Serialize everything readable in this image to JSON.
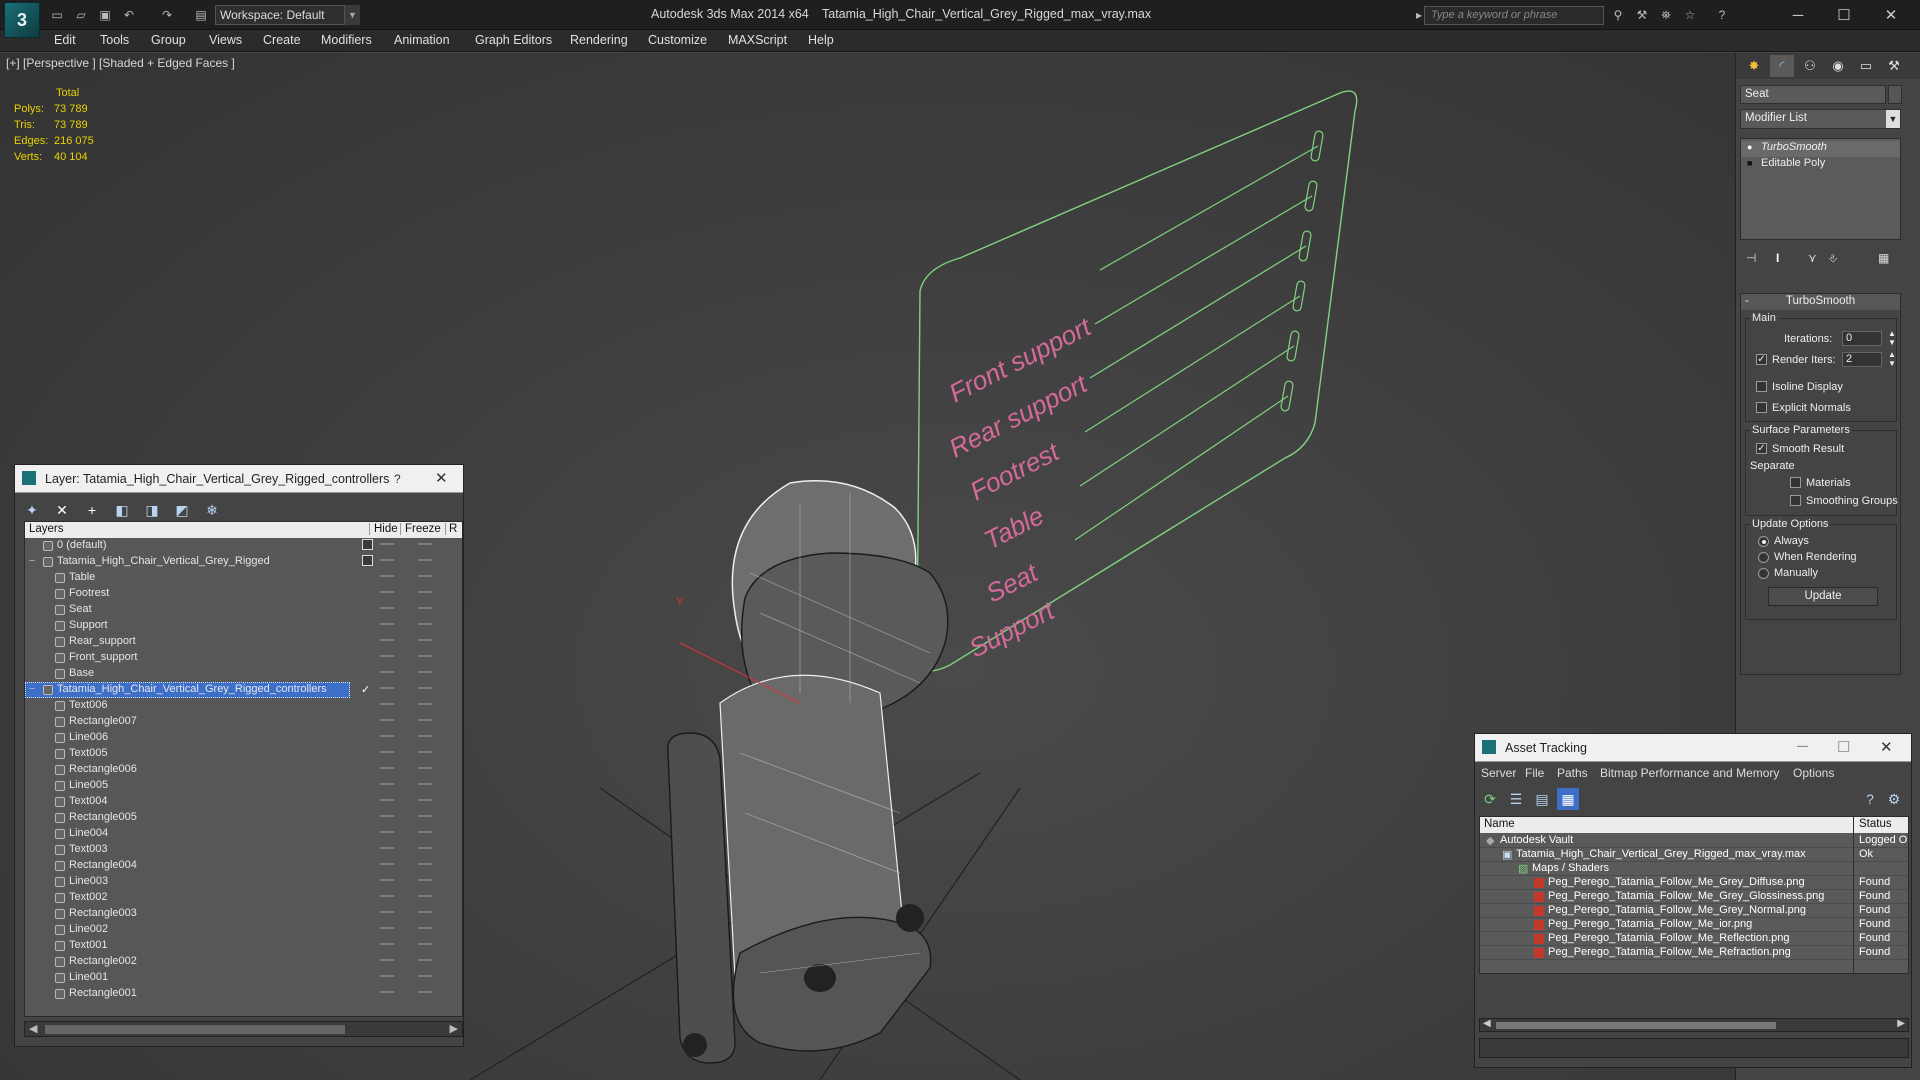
{
  "titlebar": {
    "workspace": "Workspace: Default",
    "app_title": "Autodesk 3ds Max  2014 x64",
    "file_title": "Tatamia_High_Chair_Vertical_Grey_Rigged_max_vray.max",
    "search_placeholder": "Type a keyword or phrase"
  },
  "menubar": [
    "Edit",
    "Tools",
    "Group",
    "Views",
    "Create",
    "Modifiers",
    "Animation",
    "Graph Editors",
    "Rendering",
    "Customize",
    "MAXScript",
    "Help"
  ],
  "viewport": {
    "label": "[+] [Perspective ] [Shaded + Edged Faces ]",
    "stats": {
      "header": "Total",
      "rows": [
        {
          "k": "Polys:",
          "v": "73 789"
        },
        {
          "k": "Tris:",
          "v": "73 789"
        },
        {
          "k": "Edges:",
          "v": "216 075"
        },
        {
          "k": "Verts:",
          "v": "40 104"
        }
      ]
    },
    "controller_labels": [
      "Front support",
      "Rear support",
      "Footrest",
      "Table",
      "Seat",
      "Support"
    ],
    "axis_y": "Y"
  },
  "layer_dialog": {
    "title": "Layer: Tatamia_High_Chair_Vertical_Grey_Rigged_controllers",
    "help": "?",
    "columns": {
      "layers": "Layers",
      "hide": "Hide",
      "freeze": "Freeze",
      "render": "R"
    },
    "rows": [
      {
        "name": "0 (default)",
        "level": 0,
        "kind": "layer",
        "check": true
      },
      {
        "name": "Tatamia_High_Chair_Vertical_Grey_Rigged",
        "level": 0,
        "kind": "layer",
        "check": true,
        "expander": "−"
      },
      {
        "name": "Table",
        "level": 1,
        "kind": "obj"
      },
      {
        "name": "Footrest",
        "level": 1,
        "kind": "obj"
      },
      {
        "name": "Seat",
        "level": 1,
        "kind": "obj"
      },
      {
        "name": "Support",
        "level": 1,
        "kind": "obj"
      },
      {
        "name": "Rear_support",
        "level": 1,
        "kind": "obj"
      },
      {
        "name": "Front_support",
        "level": 1,
        "kind": "obj"
      },
      {
        "name": "Base",
        "level": 1,
        "kind": "obj"
      },
      {
        "name": "Tatamia_High_Chair_Vertical_Grey_Rigged_controllers",
        "level": 0,
        "kind": "layer",
        "selected": true,
        "active": "✓",
        "expander": "−"
      },
      {
        "name": "Text006",
        "level": 1,
        "kind": "obj"
      },
      {
        "name": "Rectangle007",
        "level": 1,
        "kind": "obj"
      },
      {
        "name": "Line006",
        "level": 1,
        "kind": "obj"
      },
      {
        "name": "Text005",
        "level": 1,
        "kind": "obj"
      },
      {
        "name": "Rectangle006",
        "level": 1,
        "kind": "obj"
      },
      {
        "name": "Line005",
        "level": 1,
        "kind": "obj"
      },
      {
        "name": "Text004",
        "level": 1,
        "kind": "obj"
      },
      {
        "name": "Rectangle005",
        "level": 1,
        "kind": "obj"
      },
      {
        "name": "Line004",
        "level": 1,
        "kind": "obj"
      },
      {
        "name": "Text003",
        "level": 1,
        "kind": "obj"
      },
      {
        "name": "Rectangle004",
        "level": 1,
        "kind": "obj"
      },
      {
        "name": "Line003",
        "level": 1,
        "kind": "obj"
      },
      {
        "name": "Text002",
        "level": 1,
        "kind": "obj"
      },
      {
        "name": "Rectangle003",
        "level": 1,
        "kind": "obj"
      },
      {
        "name": "Line002",
        "level": 1,
        "kind": "obj"
      },
      {
        "name": "Text001",
        "level": 1,
        "kind": "obj"
      },
      {
        "name": "Rectangle002",
        "level": 1,
        "kind": "obj"
      },
      {
        "name": "Line001",
        "level": 1,
        "kind": "obj"
      },
      {
        "name": "Rectangle001",
        "level": 1,
        "kind": "obj"
      }
    ]
  },
  "command_panel": {
    "object_name": "Seat",
    "modifier_list": "Modifier List",
    "stack": [
      "TurboSmooth",
      "Editable Poly"
    ],
    "turbosmooth": {
      "title": "TurboSmooth",
      "main": "Main",
      "iterations_label": "Iterations:",
      "iterations": "0",
      "render_iters_label": "Render Iters:",
      "render_iters": "2",
      "render_iters_checked": true,
      "isoline": "Isoline Display",
      "explicit": "Explicit Normals",
      "surface_params": "Surface Parameters",
      "smooth_result": "Smooth Result",
      "separate": "Separate",
      "materials": "Materials",
      "smoothing_groups": "Smoothing Groups",
      "update_options": "Update Options",
      "always": "Always",
      "when_rendering": "When Rendering",
      "manually": "Manually",
      "update_button": "Update"
    }
  },
  "asset_tracking": {
    "title": "Asset Tracking",
    "menu": [
      "Server",
      "File",
      "Paths",
      "Bitmap Performance and Memory",
      "Options"
    ],
    "columns": {
      "name": "Name",
      "status": "Status"
    },
    "rows": [
      {
        "name": "Autodesk Vault",
        "status": "Logged O",
        "indent": 0,
        "icon": "vault"
      },
      {
        "name": "Tatamia_High_Chair_Vertical_Grey_Rigged_max_vray.max",
        "status": "Ok",
        "indent": 1,
        "icon": "max"
      },
      {
        "name": "Maps / Shaders",
        "status": "",
        "indent": 2,
        "icon": "maps"
      },
      {
        "name": "Peg_Perego_Tatamia_Follow_Me_Grey_Diffuse.png",
        "status": "Found",
        "indent": 3,
        "icon": "png"
      },
      {
        "name": "Peg_Perego_Tatamia_Follow_Me_Grey_Glossiness.png",
        "status": "Found",
        "indent": 3,
        "icon": "png"
      },
      {
        "name": "Peg_Perego_Tatamia_Follow_Me_Grey_Normal.png",
        "status": "Found",
        "indent": 3,
        "icon": "png"
      },
      {
        "name": "Peg_Perego_Tatamia_Follow_Me_ior.png",
        "status": "Found",
        "indent": 3,
        "icon": "png"
      },
      {
        "name": "Peg_Perego_Tatamia_Follow_Me_Reflection.png",
        "status": "Found",
        "indent": 3,
        "icon": "png"
      },
      {
        "name": "Peg_Perego_Tatamia_Follow_Me_Refraction.png",
        "status": "Found",
        "indent": 3,
        "icon": "png"
      }
    ]
  },
  "colors": {
    "selection": "#3d6fc9",
    "controller_text": "#d56a9a",
    "controller_line": "#7fd27f",
    "stats_text": "#e8d200"
  }
}
